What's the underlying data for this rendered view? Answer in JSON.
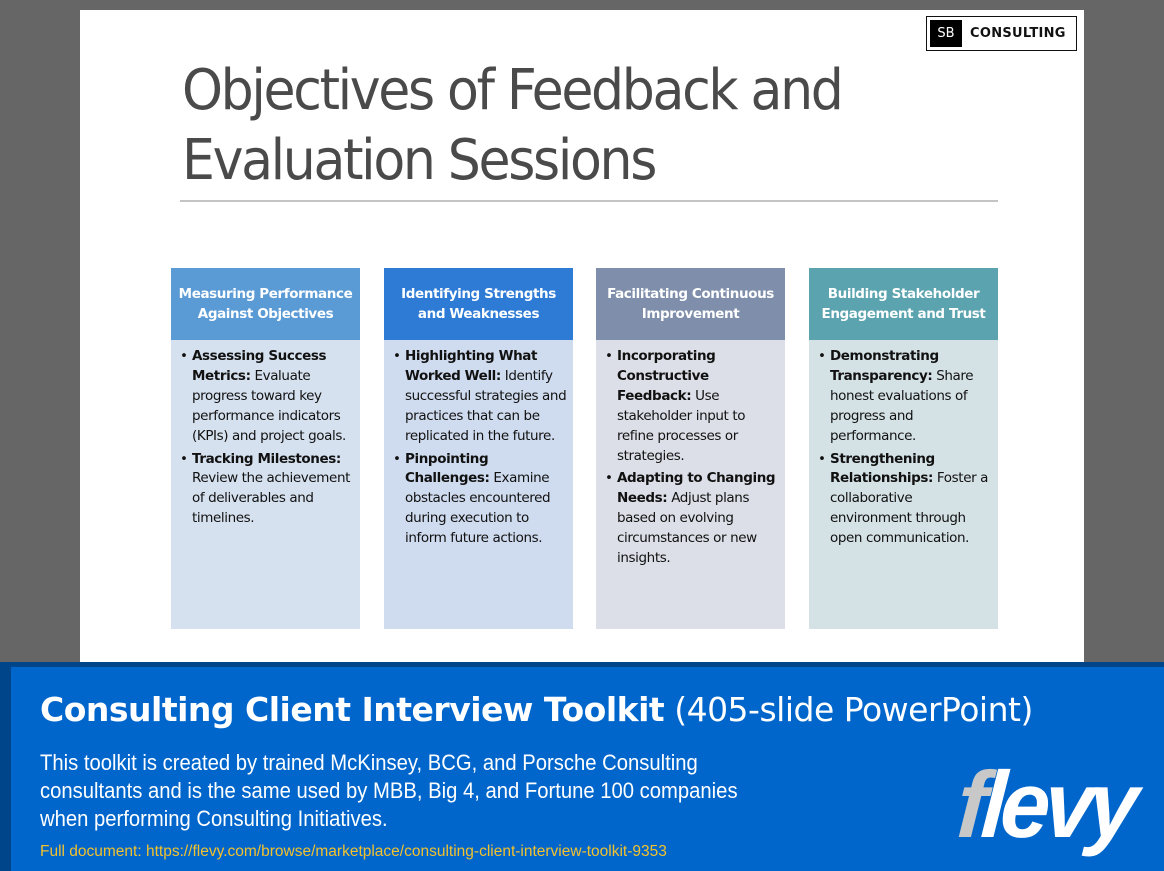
{
  "slide": {
    "logo": {
      "badge": "SB",
      "text": "CONSULTING"
    },
    "title_line1": "Objectives of Feedback and",
    "title_line2": "Evaluation Sessions",
    "columns": [
      {
        "header": "Measuring Performance Against Objectives",
        "header_color": "#5b9bd5",
        "body_color": "#d6e1ef",
        "bullets": [
          {
            "bold": "Assessing Success Metrics:",
            "text": " Evaluate progress toward key performance indicators (KPIs) and project goals."
          },
          {
            "bold": "Tracking Milestones:",
            "text": " Review the achievement of deliverables and timelines."
          }
        ]
      },
      {
        "header": "Identifying Strengths and Weaknesses",
        "header_color": "#2e7bd6",
        "body_color": "#cfdbee",
        "bullets": [
          {
            "bold": "Highlighting What Worked Well:",
            "text": " Identify successful strategies and practices that can be replicated in the future."
          },
          {
            "bold": "Pinpointing Challenges:",
            "text": " Examine obstacles encountered during execution to inform future actions."
          }
        ]
      },
      {
        "header": "Facilitating Continuous Improvement",
        "header_color": "#7f8fab",
        "body_color": "#dcdfe7",
        "bullets": [
          {
            "bold": "Incorporating Constructive Feedback:",
            "text": " Use stakeholder input to refine processes or strategies."
          },
          {
            "bold": "Adapting to Changing Needs:",
            "text": " Adjust plans based on evolving circumstances or new insights."
          }
        ]
      },
      {
        "header": "Building Stakeholder Engagement and Trust",
        "header_color": "#5ba3ae",
        "body_color": "#d4e1e5",
        "bullets": [
          {
            "bold": "Demonstrating Transparency:",
            "text": " Share honest evaluations of progress and performance."
          },
          {
            "bold": "Strengthening Relationships:",
            "text": " Foster a collaborative environment through open communication."
          }
        ]
      }
    ]
  },
  "banner": {
    "title_bold": "Consulting Client Interview Toolkit",
    "title_rest": " (405-slide PowerPoint)",
    "description": "This toolkit is created by trained McKinsey, BCG, and Porsche Consulting consultants and is the same used by MBB, Big 4, and Fortune 100 companies when performing Consulting Initiatives.",
    "link": "Full document: https://flevy.com/browse/marketplace/consulting-client-interview-toolkit-9353",
    "brand_first": "f",
    "brand_rest": "levy"
  }
}
